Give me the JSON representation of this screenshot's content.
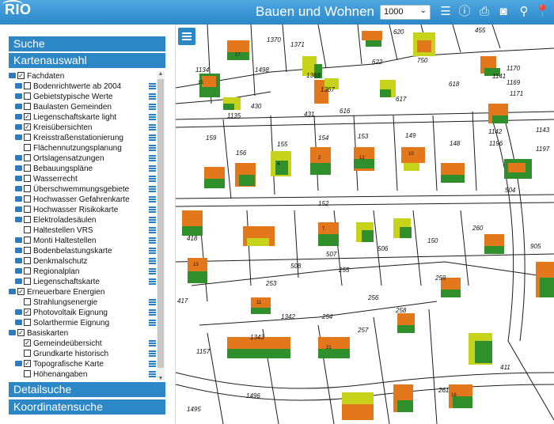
{
  "app": {
    "logo": "RIO",
    "title": "Bauen und Wohnen",
    "scale": "1000"
  },
  "toolbar": {
    "icons": [
      "list-icon",
      "info-icon",
      "print-icon",
      "camera-icon",
      "location-pin-icon",
      "pin-icon"
    ]
  },
  "sidebar": {
    "headers": {
      "suche": "Suche",
      "kartenauswahl": "Kartenauswahl",
      "detailsuche": "Detailsuche",
      "koordinatensuche": "Koordinatensuche"
    },
    "tree": [
      {
        "label": "Fachdaten",
        "level": 0,
        "folder": true,
        "checked": true,
        "menu": false
      },
      {
        "label": "Bodenrichtwerte ab 2004",
        "level": 1,
        "folder": true,
        "checked": false,
        "menu": true
      },
      {
        "label": "Gebietstypische Werte",
        "level": 1,
        "folder": true,
        "checked": false,
        "menu": true
      },
      {
        "label": "Baulasten Gemeinden",
        "level": 1,
        "folder": true,
        "checked": false,
        "menu": true
      },
      {
        "label": "Liegenschaftskarte light",
        "level": 1,
        "folder": true,
        "checked": true,
        "menu": true
      },
      {
        "label": "Kreisübersichten",
        "level": 1,
        "folder": true,
        "checked": true,
        "menu": true
      },
      {
        "label": "Kreisstraßenstationierung",
        "level": 1,
        "folder": true,
        "checked": false,
        "menu": true
      },
      {
        "label": "Flächennutzungsplanung",
        "level": 1,
        "folder": false,
        "checked": false,
        "menu": true
      },
      {
        "label": "Ortslagensatzungen",
        "level": 1,
        "folder": true,
        "checked": false,
        "menu": true
      },
      {
        "label": "Bebauungspläne",
        "level": 1,
        "folder": true,
        "checked": false,
        "menu": true
      },
      {
        "label": "Wasserrecht",
        "level": 1,
        "folder": true,
        "checked": false,
        "menu": true
      },
      {
        "label": "Überschwemmungsgebiete",
        "level": 1,
        "folder": true,
        "checked": false,
        "menu": true
      },
      {
        "label": "Hochwasser Gefahrenkarte",
        "level": 1,
        "folder": true,
        "checked": false,
        "menu": true
      },
      {
        "label": "Hochwasser Risikokarte",
        "level": 1,
        "folder": true,
        "checked": false,
        "menu": true
      },
      {
        "label": "Elektroladesäulen",
        "level": 1,
        "folder": true,
        "checked": false,
        "menu": true
      },
      {
        "label": "Haltestellen VRS",
        "level": 1,
        "folder": false,
        "checked": false,
        "menu": true
      },
      {
        "label": "Monti Haltestellen",
        "level": 1,
        "folder": true,
        "checked": false,
        "menu": true
      },
      {
        "label": "Bodenbelastungskarte",
        "level": 1,
        "folder": true,
        "checked": false,
        "menu": true
      },
      {
        "label": "Denkmalschutz",
        "level": 1,
        "folder": true,
        "checked": false,
        "menu": true
      },
      {
        "label": "Regionalplan",
        "level": 1,
        "folder": true,
        "checked": false,
        "menu": true
      },
      {
        "label": "Liegenschaftskarte",
        "level": 1,
        "folder": true,
        "checked": false,
        "menu": true
      },
      {
        "label": "Erneuerbare Energien",
        "level": 0,
        "folder": true,
        "checked": true,
        "menu": false
      },
      {
        "label": "Strahlungsenergie",
        "level": 1,
        "folder": false,
        "checked": false,
        "menu": true
      },
      {
        "label": "Photovoltaik Eignung",
        "level": 1,
        "folder": true,
        "checked": true,
        "menu": true
      },
      {
        "label": "Solarthermie Eignung",
        "level": 1,
        "folder": true,
        "checked": false,
        "menu": true
      },
      {
        "label": "Basiskarten",
        "level": 0,
        "folder": true,
        "checked": true,
        "menu": false
      },
      {
        "label": "Gemeindeübersicht",
        "level": 1,
        "folder": false,
        "checked": true,
        "menu": true
      },
      {
        "label": "Grundkarte historisch",
        "level": 1,
        "folder": false,
        "checked": false,
        "menu": true
      },
      {
        "label": "Topografische Karte",
        "level": 1,
        "folder": true,
        "checked": true,
        "menu": true
      },
      {
        "label": "Höhenangaben",
        "level": 1,
        "folder": false,
        "checked": false,
        "menu": true
      }
    ]
  },
  "map": {
    "parcel_labels": [
      "1370",
      "1371",
      "620",
      "455",
      "1498",
      "750",
      "1368",
      "622",
      "1170",
      "1141",
      "1134",
      "1367",
      "1169",
      "616",
      "617",
      "1171",
      "430",
      "1135",
      "431",
      "618",
      "1142",
      "1143",
      "159",
      "156",
      "155",
      "154",
      "153",
      "149",
      "148",
      "1196",
      "1197",
      "504",
      "152",
      "260",
      "418",
      "507",
      "506",
      "508",
      "150",
      "253",
      "255",
      "256",
      "259",
      "417",
      "1342",
      "254",
      "258",
      "905",
      "1343",
      "257",
      "411",
      "1496",
      "1495",
      "1157",
      "261"
    ],
    "building_numbers": [
      "17",
      "15",
      "4",
      "2",
      "12",
      "10",
      "7",
      "13",
      "11",
      "21",
      "16"
    ]
  },
  "colors": {
    "header": "#2b87c6",
    "topbar": "#3a97d6",
    "pv_good": "#e2771c",
    "pv_ok": "#c7d21b",
    "pv_low": "#2f8f2a"
  }
}
